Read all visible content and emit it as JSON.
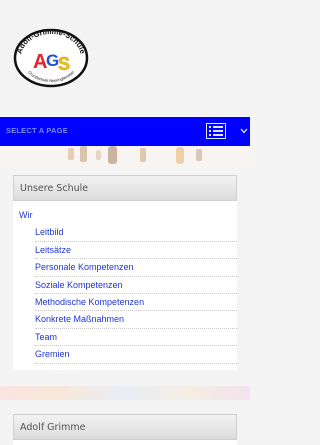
{
  "logo": {
    "top_text": "Adolf-Grimme-Schule",
    "bottom_text": "Grundschule Neuenglienicke",
    "letters": "AGS"
  },
  "nav": {
    "select_label": "SELECT A PAGE",
    "menu_icon": "list-icon",
    "toggle_icon": "chevron-down-icon"
  },
  "panel1": {
    "title": "Unsere Schule",
    "items": [
      {
        "label": "Wir"
      },
      {
        "label": "Leitbild"
      },
      {
        "label": "Leitsätze"
      },
      {
        "label": "Personale Kompetenzen"
      },
      {
        "label": "Soziale Kompetenzen"
      },
      {
        "label": "Methodische Kompetenzen"
      },
      {
        "label": "Konkrete Maßnahmen"
      },
      {
        "label": "Team"
      },
      {
        "label": "Gremien"
      }
    ]
  },
  "panel2": {
    "title": "Adolf Grimme"
  },
  "colors": {
    "nav_bg": "#0000ff",
    "link": "#1f35d6"
  }
}
